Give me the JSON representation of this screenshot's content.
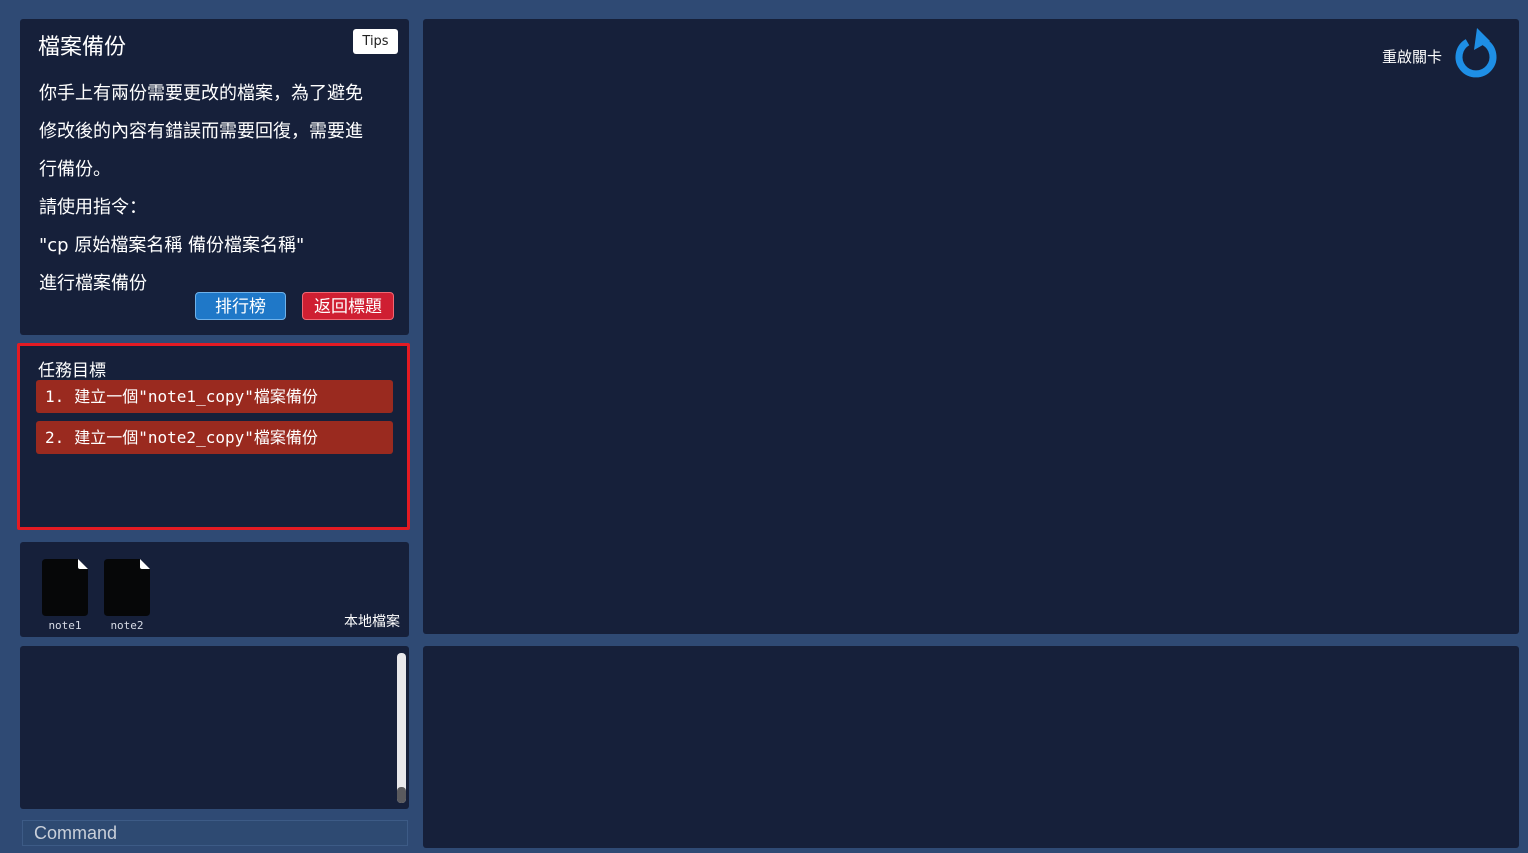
{
  "intro": {
    "title": "檔案備份",
    "tips_label": "Tips",
    "lines": [
      "你手上有兩份需要更改的檔案，為了避免",
      "修改後的內容有錯誤而需要回復，需要進",
      "行備份。",
      "請使用指令：",
      "\"cp 原始檔案名稱 備份檔案名稱\"",
      "進行檔案備份"
    ],
    "rank_label": "排行榜",
    "back_label": "返回標題"
  },
  "mission": {
    "title": "任務目標",
    "tasks": [
      {
        "num": "1.",
        "text": "建立一個\"note1_copy\"檔案備份"
      },
      {
        "num": "2.",
        "text": "建立一個\"note2_copy\"檔案備份"
      }
    ]
  },
  "files": {
    "label": "本地檔案",
    "items": [
      {
        "name": "note1",
        "icon": "file-icon"
      },
      {
        "name": "note2",
        "icon": "file-icon"
      }
    ]
  },
  "command": {
    "placeholder": "Command"
  },
  "stage": {
    "restart_label": "重啟關卡",
    "restart_icon": "restart-icon",
    "restart_color": "#1e8fe6"
  }
}
